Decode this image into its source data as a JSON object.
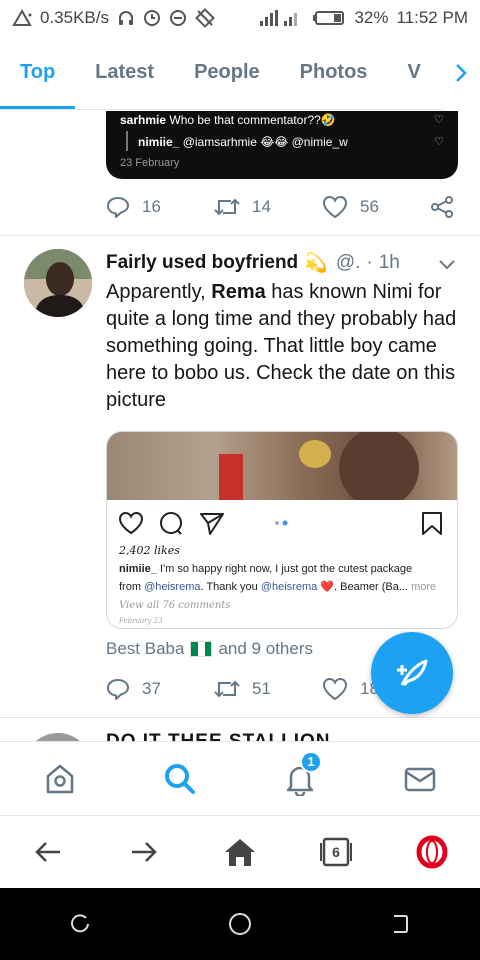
{
  "status_bar": {
    "speed": "0.35KB/s",
    "battery": "32%",
    "time": "11:52 PM"
  },
  "tabs": [
    {
      "label": "Top",
      "active": true
    },
    {
      "label": "Latest",
      "active": false
    },
    {
      "label": "People",
      "active": false
    },
    {
      "label": "Photos",
      "active": false
    },
    {
      "label": "V",
      "active": false
    }
  ],
  "quoted_card": {
    "line1_user": "sarhmie",
    "line1_text": "Who be that commentator??🤣",
    "line2_user": "nimiie_",
    "line2_text": "@iamsarhmie 😂😂 @nimie_w",
    "date": "23 February"
  },
  "prev_tweet_actions": {
    "replies": "16",
    "retweets": "14",
    "likes": "56"
  },
  "tweet": {
    "author_name": "Fairly used boyfriend",
    "author_emoji": "💫",
    "handle": "@.",
    "separator": "·",
    "time": "1h",
    "text_before_bold": "Apparently, ",
    "text_bold": "Rema",
    "text_after_bold": " has known Nimi for quite a long time and they probably had something going. That little boy came here to bobo us. Check the date on this picture",
    "media": {
      "likes": "2,402 likes",
      "caption_user": "nimiie_",
      "caption_line1": "I'm so happy right now, I just got the cutest package",
      "caption_from": "from ",
      "mention1": "@heisrema",
      "caption_mid": ". Thank you ",
      "mention2": "@heisrema",
      "caption_heart": "❤️",
      "caption_tail": ". Beamer (Ba...",
      "more": "more",
      "view_all": "View all 76 comments",
      "date": "February 23"
    },
    "social_context_name": "Best Baba",
    "social_context_tail": "and 9 others",
    "replies": "37",
    "retweets": "51",
    "likes": "18"
  },
  "next_tweet": {
    "author_name": "DO IT THEE STALLION"
  },
  "bottom_nav": {
    "notification_count": "1"
  },
  "browser": {
    "tab_count": "6"
  },
  "colors": {
    "accent": "#1da1f2",
    "text_secondary": "#657786",
    "opera_red": "#e0001b",
    "flag_green": "#008751"
  }
}
